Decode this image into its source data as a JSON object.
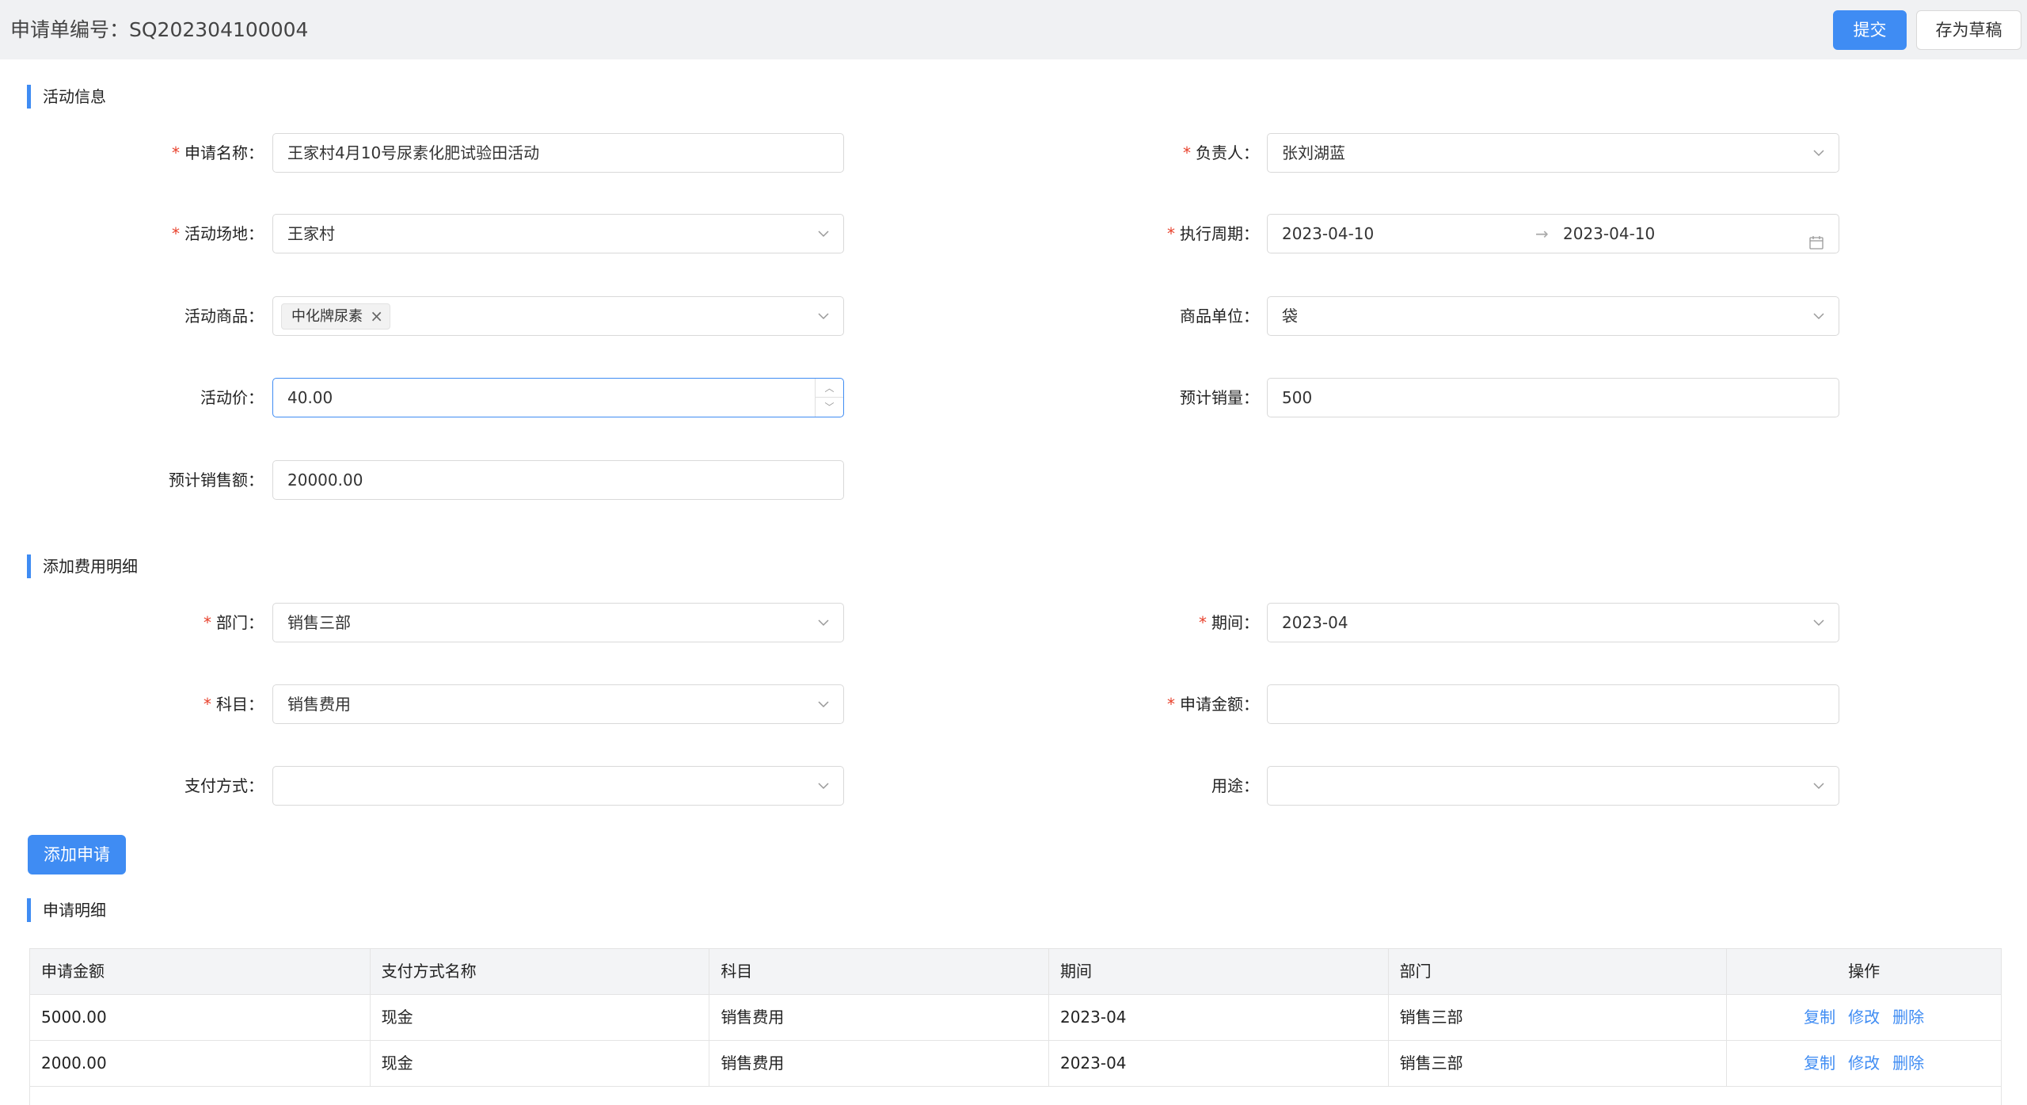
{
  "header": {
    "title": "申请单编号：SQ202304100004",
    "submit_label": "提交",
    "draft_label": "存为草稿"
  },
  "activity_section": {
    "title": "活动信息",
    "name": {
      "label": "申请名称：",
      "required": true,
      "value": "王家村4月10号尿素化肥试验田活动"
    },
    "owner": {
      "label": "负责人：",
      "required": true,
      "value": "张刘湖蓝"
    },
    "venue": {
      "label": "活动场地：",
      "required": true,
      "value": "王家村"
    },
    "period": {
      "label": "执行周期：",
      "required": true,
      "start": "2023-04-10",
      "end": "2023-04-10",
      "separator": "→"
    },
    "product": {
      "label": "活动商品：",
      "tag": "中化牌尿素"
    },
    "unit": {
      "label": "商品单位：",
      "value": "袋"
    },
    "price": {
      "label": "活动价：",
      "value": "40.00"
    },
    "sales_volume": {
      "label": "预计销量：",
      "value": "500"
    },
    "sales_amount": {
      "label": "预计销售额：",
      "value": "20000.00"
    }
  },
  "expense_section": {
    "title": "添加费用明细",
    "department": {
      "label": "部门：",
      "required": true,
      "value": "销售三部"
    },
    "term": {
      "label": "期间：",
      "required": true,
      "value": "2023-04"
    },
    "subject": {
      "label": "科目：",
      "required": true,
      "value": "销售费用"
    },
    "amount": {
      "label": "申请金额：",
      "required": true,
      "value": ""
    },
    "payment": {
      "label": "支付方式：",
      "value": ""
    },
    "usage": {
      "label": "用途：",
      "value": ""
    },
    "add_button": "添加申请"
  },
  "detail_section": {
    "title": "申请明细",
    "columns": [
      "申请金额",
      "支付方式名称",
      "科目",
      "期间",
      "部门",
      "操作"
    ],
    "rows": [
      {
        "amount": "5000.00",
        "payment": "现金",
        "subject": "销售费用",
        "term": "2023-04",
        "department": "销售三部"
      },
      {
        "amount": "2000.00",
        "payment": "现金",
        "subject": "销售费用",
        "term": "2023-04",
        "department": "销售三部"
      }
    ],
    "actions": {
      "copy": "复制",
      "edit": "修改",
      "delete": "删除"
    }
  },
  "colors": {
    "accent": "#3f8cf3",
    "required": "#e8412c",
    "header_bg": "#f0f1f3"
  },
  "icons": {
    "select": "chevron-down-icon",
    "calendar": "calendar-icon",
    "close": "close-icon"
  }
}
